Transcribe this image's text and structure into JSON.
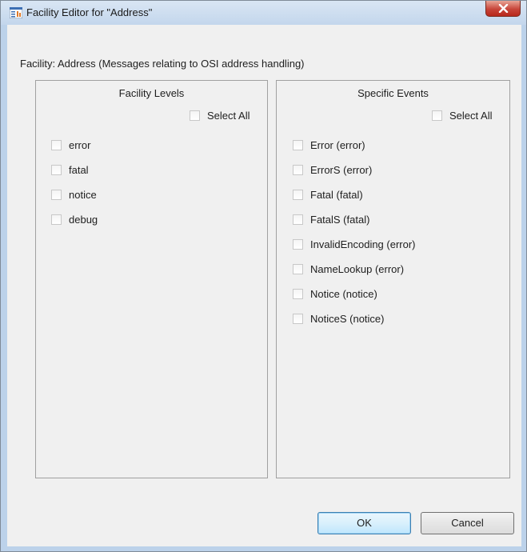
{
  "window": {
    "title": "Facility Editor for \"Address\""
  },
  "facility_label": "Facility: Address (Messages relating to OSI address handling)",
  "levels": {
    "title": "Facility Levels",
    "select_all": "Select All",
    "items": [
      {
        "label": "error",
        "checked": false
      },
      {
        "label": "fatal",
        "checked": false
      },
      {
        "label": "notice",
        "checked": false
      },
      {
        "label": "debug",
        "checked": false
      }
    ]
  },
  "events": {
    "title": "Specific Events",
    "select_all": "Select All",
    "items": [
      {
        "label": "Error (error)",
        "checked": false
      },
      {
        "label": "ErrorS (error)",
        "checked": false
      },
      {
        "label": "Fatal (fatal)",
        "checked": false
      },
      {
        "label": "FatalS (fatal)",
        "checked": false
      },
      {
        "label": "InvalidEncoding (error)",
        "checked": false
      },
      {
        "label": "NameLookup (error)",
        "checked": false
      },
      {
        "label": "Notice (notice)",
        "checked": false
      },
      {
        "label": "NoticeS (notice)",
        "checked": false
      }
    ]
  },
  "buttons": {
    "ok": "OK",
    "cancel": "Cancel"
  },
  "icons": {
    "app": "list-icon",
    "close": "close-icon"
  },
  "colors": {
    "title_bar": "#c3d6ec",
    "close_button": "#c7453a",
    "dialog_bg": "#f0f0f0",
    "default_button_border": "#3c7fb1"
  }
}
